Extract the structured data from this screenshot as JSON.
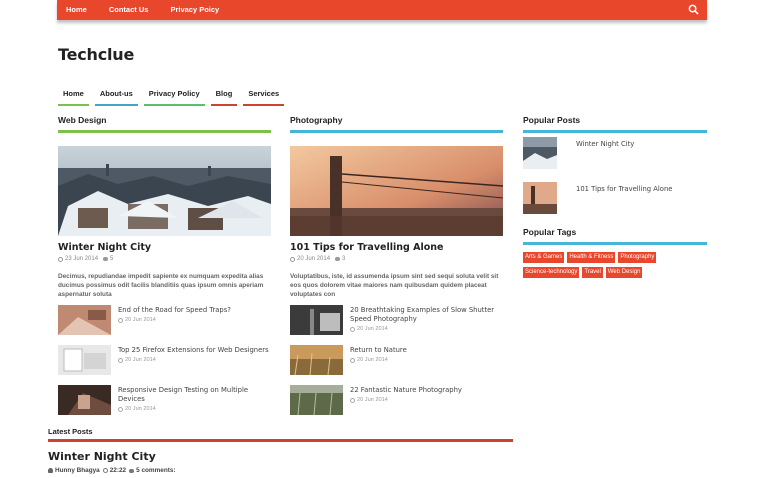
{
  "topnav": {
    "items": [
      "Home",
      "Contact Us",
      "Privacy Poicy"
    ]
  },
  "site": {
    "title": "Techclue"
  },
  "mainnav": {
    "items": [
      {
        "label": "Home",
        "color": "#7dc04b"
      },
      {
        "label": "About-us",
        "color": "#45a3c9"
      },
      {
        "label": "Privacy Policy",
        "color": "#5bbf6f"
      },
      {
        "label": "Blog",
        "color": "#c94532"
      },
      {
        "label": "Services",
        "color": "#c94532"
      }
    ]
  },
  "columns": [
    {
      "title": "Web Design",
      "accent": "#7dc04b",
      "featured": {
        "title": "Winter Night City",
        "date": "23 Jun 2014",
        "comments": "5",
        "excerpt": "Decimus, repudiandae impedit sapiente ex numquam expedita alias ducimus possimus odit facilis blanditiis quas ipsum omnis aperiam aspernatur soluta"
      },
      "items": [
        {
          "title": "End of the Road for Speed Traps?",
          "date": "20 Jun 2014"
        },
        {
          "title": "Top 25 Firefox Extensions for Web Designers",
          "date": "20 Jun 2014"
        },
        {
          "title": "Responsive Design Testing on Multiple Devices",
          "date": "20 Jun 2014"
        }
      ]
    },
    {
      "title": "Photography",
      "accent": "#45b5d8",
      "featured": {
        "title": "101 Tips for Travelling Alone",
        "date": "20 Jun 2014",
        "comments": "3",
        "excerpt": "Voluptatibus, iste, id assumenda ipsum sint sed sequi soluta velit sit eos quos dolorem vitae maiores nam quibusdam quidem placeat voluptates con"
      },
      "items": [
        {
          "title": "20 Breathtaking Examples of Slow Shutter Speed Photography",
          "date": "20 Jun 2014"
        },
        {
          "title": "Return to Nature",
          "date": "20 Jun 2014"
        },
        {
          "title": "22 Fantastic Nature Photography",
          "date": "20 Jun 2014"
        }
      ]
    }
  ],
  "sidebar": {
    "popular_posts_title": "Popular Posts",
    "popular_posts": [
      "Winter Night City",
      "101 Tips for Travelling Alone"
    ],
    "popular_tags_title": "Popular Tags",
    "tags": [
      "Arts & Games",
      "Health & Fitness",
      "Photography",
      "Science-technology",
      "Travel",
      "Web Design"
    ]
  },
  "latest": {
    "title": "Latest Posts",
    "post_title": "Winter Night City",
    "author": "Hunny Bhagya",
    "time": "22:22",
    "comments": "5 comments:"
  },
  "colors": {
    "brand": "#e8472b",
    "photo_accent": "#45b5d8",
    "web_accent": "#7dc04b"
  }
}
